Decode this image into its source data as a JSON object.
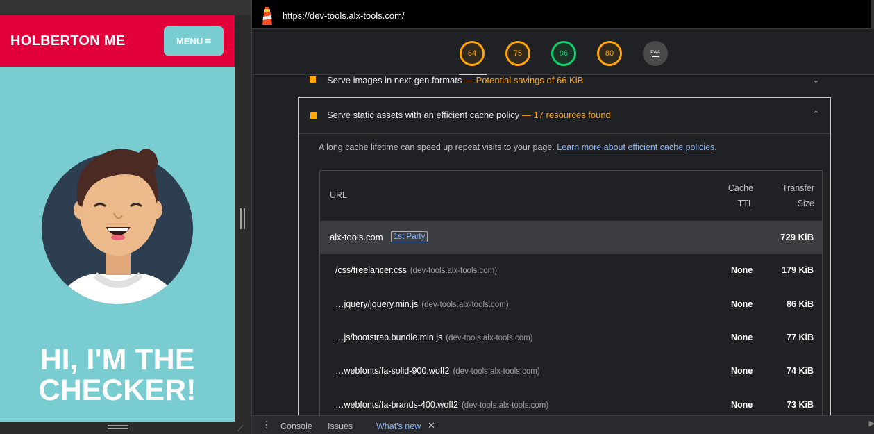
{
  "site": {
    "brand": "HOLBERTON ME",
    "menu_label": "MENU",
    "hero_line1": "HI, I'M THE",
    "hero_line2": "CHECKER!"
  },
  "devtools": {
    "url": "https://dev-tools.alx-tools.com/",
    "scores": [
      "64",
      "75",
      "96",
      "80"
    ],
    "pwa_label": "PWA",
    "score_colors": {
      "orange": "#ffa400",
      "green": "#0cce6b"
    },
    "prev_audit": {
      "title": "Serve images in next-gen formats",
      "sep": "—",
      "display": "Potential savings of 66 KiB"
    },
    "audit": {
      "title": "Serve static assets with an efficient cache policy",
      "sep": "—",
      "display": "17 resources found",
      "description": "A long cache lifetime can speed up repeat visits to your page.",
      "learn_more": "Learn more about efficient cache policies",
      "period": "."
    },
    "table": {
      "headers": {
        "url": "URL",
        "cache_line1": "Cache",
        "cache_line2": "TTL",
        "size_line1": "Transfer",
        "size_line2": "Size"
      },
      "group": {
        "url": "alx-tools.com",
        "badge": "1st Party",
        "size": "729 KiB"
      },
      "rows": [
        {
          "url": "/css/freelancer.css",
          "host": "(dev-tools.alx-tools.com)",
          "ttl": "None",
          "size": "179 KiB"
        },
        {
          "url": "…jquery/jquery.min.js",
          "host": "(dev-tools.alx-tools.com)",
          "ttl": "None",
          "size": "86 KiB"
        },
        {
          "url": "…js/bootstrap.bundle.min.js",
          "host": "(dev-tools.alx-tools.com)",
          "ttl": "None",
          "size": "77 KiB"
        },
        {
          "url": "…webfonts/fa-solid-900.woff2",
          "host": "(dev-tools.alx-tools.com)",
          "ttl": "None",
          "size": "74 KiB"
        },
        {
          "url": "…webfonts/fa-brands-400.woff2",
          "host": "(dev-tools.alx-tools.com)",
          "ttl": "None",
          "size": "73 KiB"
        }
      ]
    },
    "drawer": {
      "tabs": [
        "Console",
        "Issues",
        "What's new"
      ],
      "close": "✕"
    }
  }
}
